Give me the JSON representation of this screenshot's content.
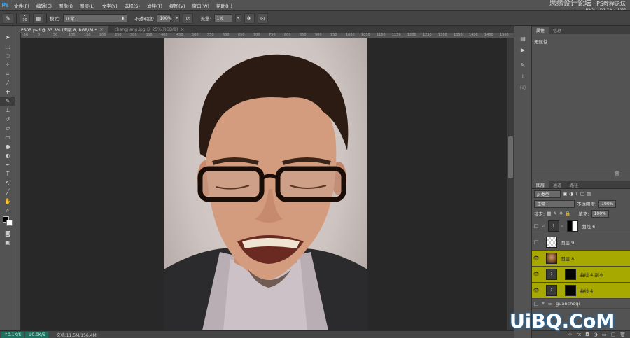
{
  "app": {
    "logo": "Ps"
  },
  "menu": [
    "文件(F)",
    "编辑(E)",
    "图像(I)",
    "图层(L)",
    "文字(Y)",
    "选择(S)",
    "滤镜(T)",
    "视图(V)",
    "窗口(W)",
    "帮助(H)"
  ],
  "watermark_top": {
    "line1": "思缘设计论坛",
    "line2": "PS教程论坛",
    "line3": "BBS.16XX8.COM"
  },
  "options": {
    "brush_size": "30",
    "mode_label": "模式:",
    "mode_value": "正常",
    "opacity_label": "不透明度:",
    "opacity_value": "100%",
    "flow_label": "流量:",
    "flow_value": "1%"
  },
  "tabs": [
    {
      "label": "PS05.psd @ 33.3% (图层 8, RGB/8) *",
      "close": "×"
    },
    {
      "label": "changjiang.jpg @ 25%(RGB/8)",
      "close": "×"
    }
  ],
  "ruler": [
    "-50",
    "0",
    "50",
    "100",
    "150",
    "200",
    "250",
    "300",
    "350",
    "400",
    "450",
    "500",
    "550",
    "600",
    "650",
    "700",
    "750",
    "800",
    "850",
    "900",
    "950",
    "1000",
    "1050",
    "1100",
    "1150",
    "1200",
    "1250",
    "1300",
    "1350",
    "1400",
    "1450",
    "1500"
  ],
  "status": {
    "net_up": "0.1K/S",
    "net_down": "0.0K/S",
    "doc": "文档:11.5M/156.4M"
  },
  "properties": {
    "tab_active": "属性",
    "tab_other": "信息",
    "body": "无属性"
  },
  "layers_panel": {
    "tabs": [
      "图层",
      "通道",
      "路径"
    ],
    "filter_kind": "ρ 类型",
    "blend_mode": "正常",
    "opacity_label": "不透明度:",
    "opacity_value": "100%",
    "lock_label": "锁定:",
    "fill_label": "填充:",
    "fill_value": "100%",
    "layers": [
      {
        "name": "曲线 6",
        "type": "curves-mask",
        "visible": false,
        "highlight": false
      },
      {
        "name": "图层 9",
        "type": "transparent",
        "visible": false,
        "highlight": false
      },
      {
        "name": "图层 8",
        "type": "photo",
        "visible": true,
        "highlight": true
      },
      {
        "name": "曲线 4 副本",
        "type": "curves-dark",
        "visible": true,
        "highlight": true
      },
      {
        "name": "曲线 4",
        "type": "curves-dark",
        "visible": true,
        "highlight": true
      },
      {
        "name": "guancheqi",
        "type": "group",
        "visible": false,
        "highlight": false
      }
    ]
  },
  "watermark_bottom": "UiBQ.CoM",
  "colors": {
    "accent": "#31a8ff",
    "layer_highlight": "#a7a800",
    "panel": "#535353",
    "canvas": "#282828"
  }
}
